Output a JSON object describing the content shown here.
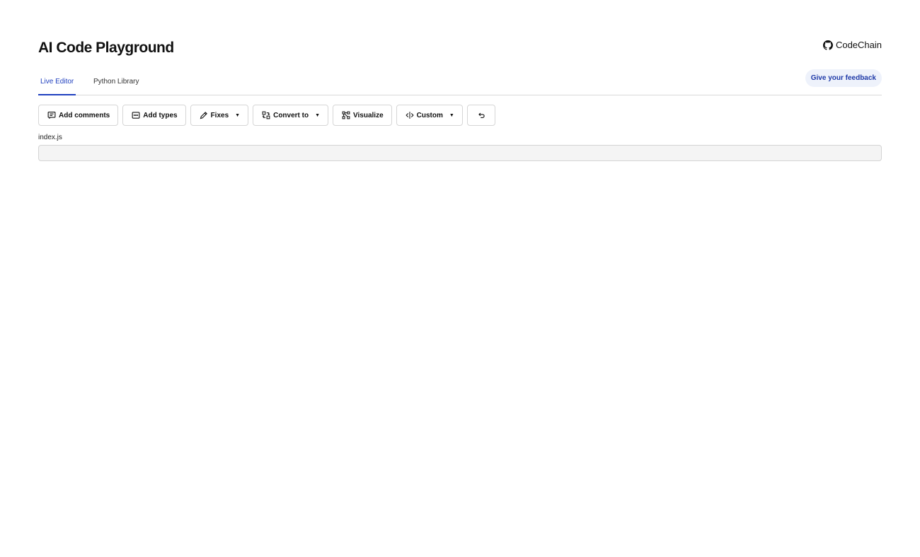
{
  "header": {
    "title": "AI Code Playground",
    "repo_link_label": "CodeChain",
    "repo_icon": "github-icon"
  },
  "tabs": [
    {
      "label": "Live Editor",
      "active": true
    },
    {
      "label": "Python Library",
      "active": false
    }
  ],
  "feedback": {
    "label": "Give your feedback"
  },
  "toolbar": {
    "items": [
      {
        "label": "Add comments",
        "icon": "comment-icon",
        "dropdown": false
      },
      {
        "label": "Add types",
        "icon": "types-icon",
        "dropdown": false
      },
      {
        "label": "Fixes",
        "icon": "pencil-icon",
        "dropdown": true
      },
      {
        "label": "Convert to",
        "icon": "convert-icon",
        "dropdown": true
      },
      {
        "label": "Visualize",
        "icon": "visualize-icon",
        "dropdown": false
      },
      {
        "label": "Custom",
        "icon": "custom-icon",
        "dropdown": true
      }
    ],
    "caret": "▼",
    "undo_icon": "undo-icon"
  },
  "editor": {
    "filename": "index.js",
    "content": ""
  },
  "colors": {
    "accent": "#1f3fbf",
    "feedback_bg": "#eef2fb",
    "editor_bg": "#f4f4f4",
    "border": "#d6d6d6"
  }
}
